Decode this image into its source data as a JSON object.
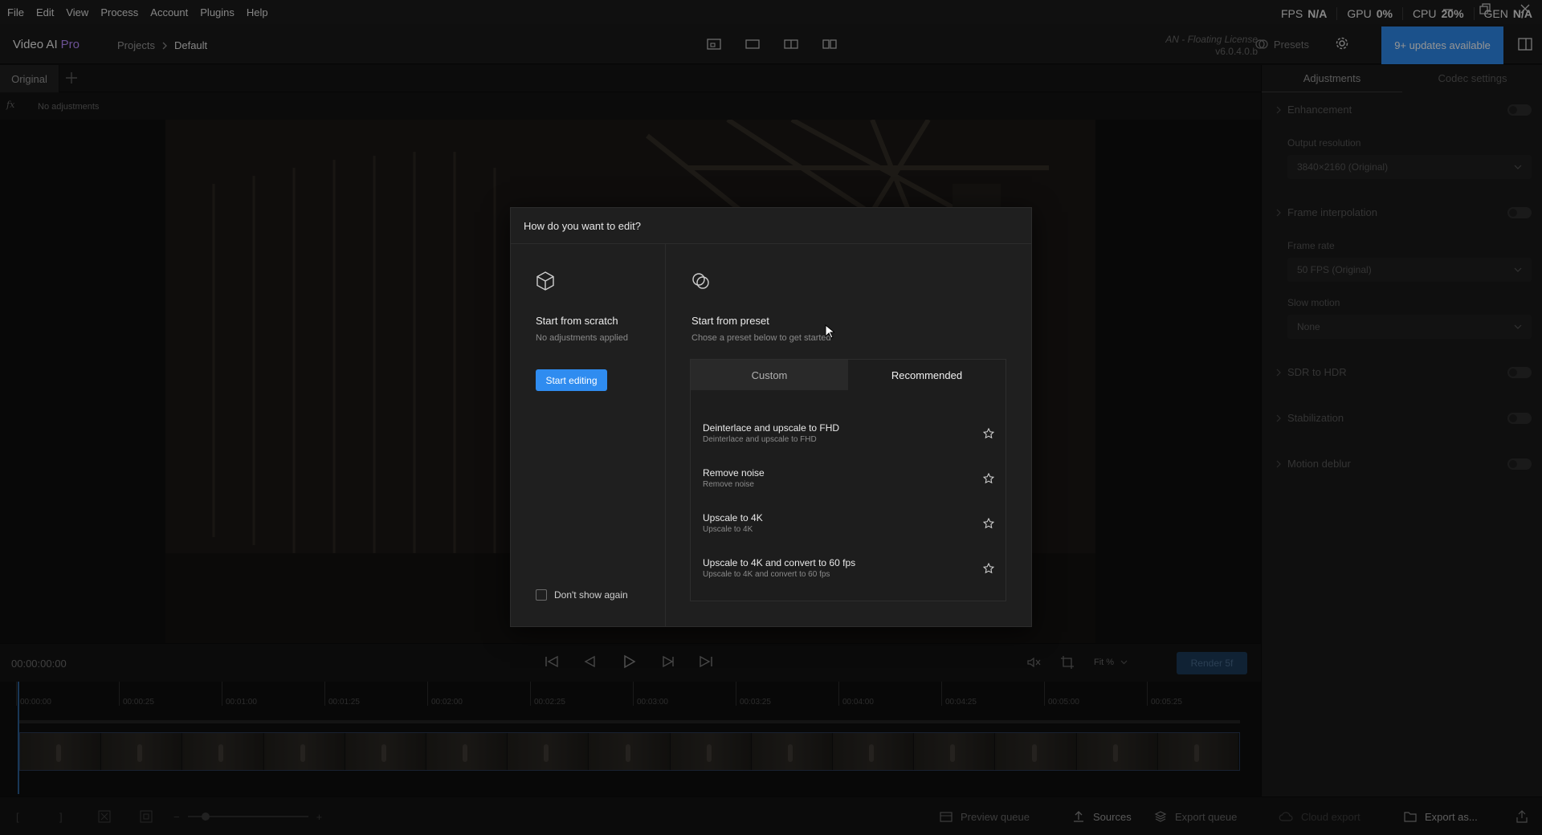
{
  "menubar": {
    "items": [
      "File",
      "Edit",
      "View",
      "Process",
      "Account",
      "Plugins",
      "Help"
    ]
  },
  "system_stats": {
    "fps_label": "FPS",
    "fps_value": "N/A",
    "gpu_label": "GPU",
    "gpu_value": "0%",
    "cpu_label": "CPU",
    "cpu_value": "20%",
    "mem_label": "GEN",
    "mem_value": "N/A"
  },
  "header": {
    "app_name": "Video AI",
    "app_edition": "Pro",
    "breadcrumb": [
      "Projects",
      "Default"
    ],
    "license_text": "AN - Floating License",
    "version": "v6.0.4.0.b",
    "presets_label": "Presets",
    "updates_label": "9+ updates available"
  },
  "tabs": {
    "original_label": "Original"
  },
  "fx_bar": {
    "fx_label": "fx",
    "status": "No adjustments"
  },
  "right_panel": {
    "tabs": [
      "Adjustments",
      "Codec settings"
    ],
    "sections": {
      "enhancement": "Enhancement",
      "output_resolution_label": "Output resolution",
      "output_resolution_value": "3840×2160 (Original)",
      "frame_interpolation": "Frame interpolation",
      "frame_rate_label": "Frame rate",
      "frame_rate_value": "50 FPS (Original)",
      "slow_motion_label": "Slow motion",
      "slow_motion_value": "None",
      "sdr_to_hdr": "SDR to HDR",
      "stabilization": "Stabilization",
      "motion_deblur": "Motion deblur"
    }
  },
  "timeline": {
    "timecode": "00:00:00:00",
    "zoom_label": "Fit %",
    "render_label": "Render 5f",
    "ruler": [
      "00:00:00",
      "00:00:25",
      "00:01:00",
      "00:01:25",
      "00:02:00",
      "00:02:25",
      "00:03:00",
      "00:03:25",
      "00:04:00",
      "00:04:25",
      "00:05:00",
      "00:05:25"
    ]
  },
  "bottom_bar": {
    "preview_queue": "Preview queue",
    "sources": "Sources",
    "export_queue": "Export queue",
    "cloud_export": "Cloud export",
    "export_as": "Export as..."
  },
  "dialog": {
    "title": "How do you want to edit?",
    "scratch_title": "Start from scratch",
    "scratch_subtitle": "No adjustments applied",
    "start_button": "Start editing",
    "dont_show_label": "Don't show again",
    "preset_title": "Start from preset",
    "preset_subtitle": "Chose a preset below to get started",
    "preset_tabs": [
      "Custom",
      "Recommended"
    ],
    "presets": [
      {
        "name": "Deinterlace and upscale to FHD",
        "description": "Deinterlace and upscale to FHD"
      },
      {
        "name": "Remove noise",
        "description": "Remove noise"
      },
      {
        "name": "Upscale to 4K",
        "description": "Upscale to 4K"
      },
      {
        "name": "Upscale to 4K and convert to 60 fps",
        "description": "Upscale to 4K and convert to 60 fps"
      }
    ]
  },
  "colors": {
    "accent": "#2f8cf0",
    "pro": "#b88cff",
    "background": "#121212"
  }
}
